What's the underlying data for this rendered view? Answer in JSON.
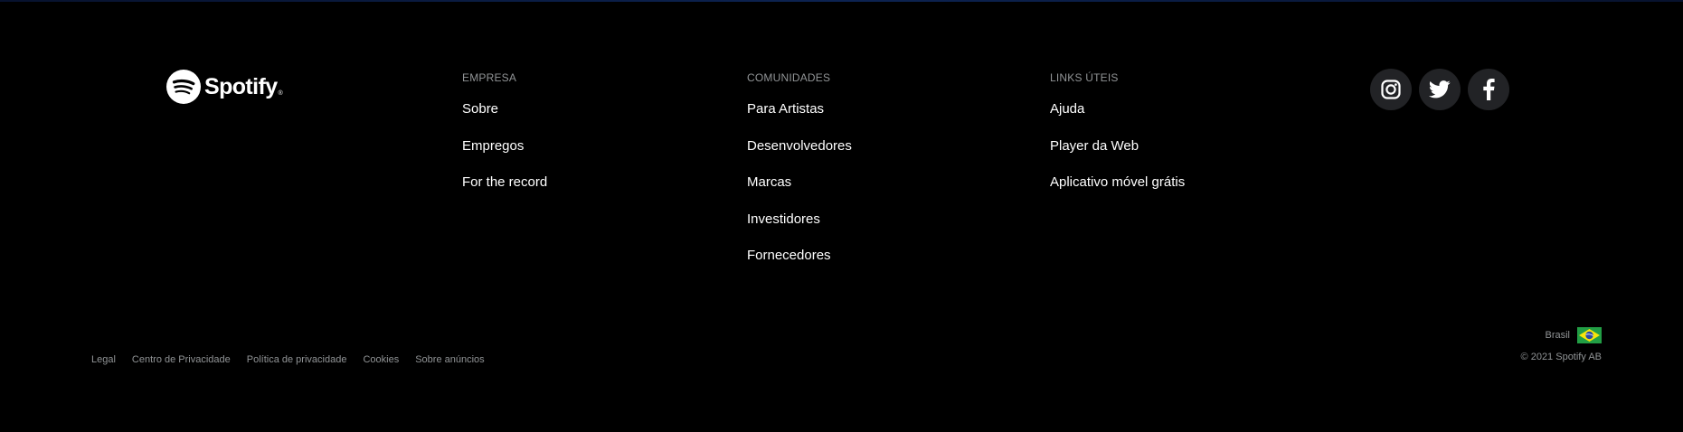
{
  "logo": {
    "text": "Spotify",
    "tm": "®"
  },
  "columns": {
    "empresa": {
      "heading": "EMPRESA",
      "items": [
        "Sobre",
        "Empregos",
        "For the record"
      ]
    },
    "comunidades": {
      "heading": "COMUNIDADES",
      "items": [
        "Para Artistas",
        "Desenvolvedores",
        "Marcas",
        "Investidores",
        "Fornecedores"
      ]
    },
    "links": {
      "heading": "LINKS ÚTEIS",
      "items": [
        "Ajuda",
        "Player da Web",
        "Aplicativo móvel grátis"
      ]
    }
  },
  "social": [
    {
      "icon": "instagram-icon"
    },
    {
      "icon": "twitter-icon"
    },
    {
      "icon": "facebook-icon"
    }
  ],
  "bottom_links": [
    "Legal",
    "Centro de Privacidade",
    "Política de privacidade",
    "Cookies",
    "Sobre anúncios"
  ],
  "country": {
    "label": "Brasil",
    "flag_icon": "brazil-flag-icon"
  },
  "copyright": "© 2021 Spotify AB",
  "colors": {
    "background": "#000000",
    "muted_text": "#919496",
    "link_text": "#ffffff",
    "social_bg": "#222326"
  }
}
